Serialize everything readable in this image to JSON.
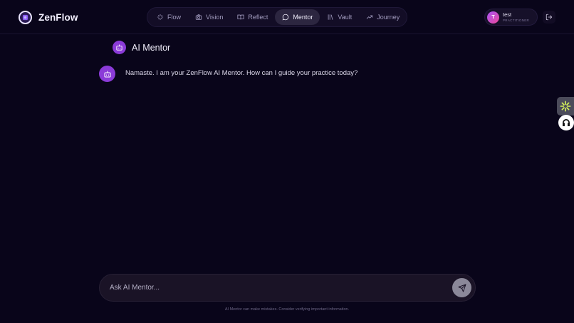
{
  "brand": {
    "name": "ZenFlow"
  },
  "nav": {
    "items": [
      {
        "label": "Flow",
        "icon": "sparkles-icon",
        "active": false
      },
      {
        "label": "Vision",
        "icon": "camera-icon",
        "active": false
      },
      {
        "label": "Reflect",
        "icon": "book-icon",
        "active": false
      },
      {
        "label": "Mentor",
        "icon": "chat-bubble-icon",
        "active": true
      },
      {
        "label": "Vault",
        "icon": "library-icon",
        "active": false
      },
      {
        "label": "Journey",
        "icon": "trending-up-icon",
        "active": false
      }
    ]
  },
  "user": {
    "initial": "T",
    "name": "test",
    "role": "PRACTITIONER"
  },
  "page": {
    "title": "AI Mentor"
  },
  "messages": [
    {
      "role": "assistant",
      "text": "Namaste. I am your ZenFlow AI Mentor. How can I guide your practice today?"
    }
  ],
  "input": {
    "placeholder": "Ask AI Mentor...",
    "value": ""
  },
  "disclaimer": "AI Mentor can make mistakes. Consider verifying important information.",
  "colors": {
    "background": "#09051a",
    "accent_purple": "#8b3bd8",
    "active_tab": "#2c2640",
    "send_button": "#8b8899"
  }
}
